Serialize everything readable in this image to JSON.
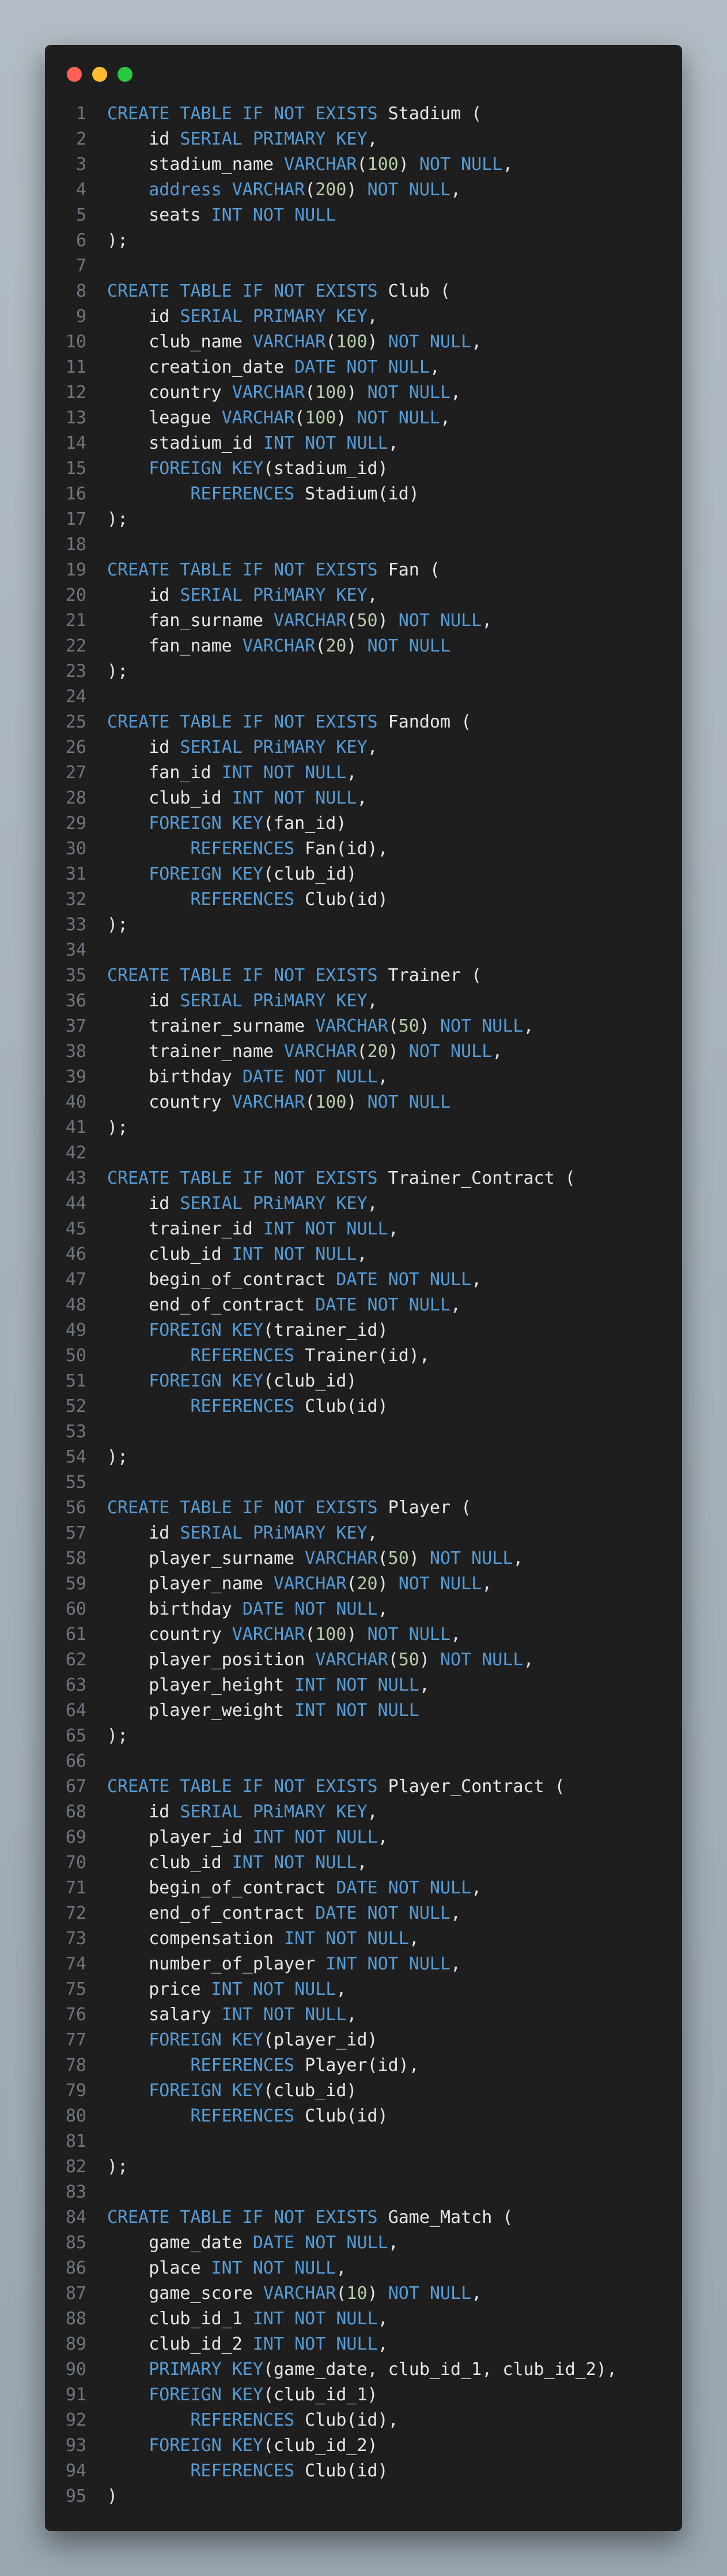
{
  "window": {
    "controls": [
      "close",
      "minimize",
      "maximize"
    ]
  },
  "colors": {
    "keyword": "#569cd6",
    "number": "#b5cea8",
    "text": "#e6e6e6",
    "line_number": "#6e7681",
    "background": "#1e1e1e"
  },
  "code": {
    "lines": [
      [
        [
          "k",
          "CREATE TABLE IF NOT EXISTS"
        ],
        [
          "p",
          " Stadium ("
        ]
      ],
      [
        [
          "p",
          "    id "
        ],
        [
          "k",
          "SERIAL PRIMARY KEY"
        ],
        [
          "p",
          ","
        ]
      ],
      [
        [
          "p",
          "    stadium_name "
        ],
        [
          "k",
          "VARCHAR"
        ],
        [
          "p",
          "("
        ],
        [
          "n",
          "100"
        ],
        [
          "p",
          ") "
        ],
        [
          "k",
          "NOT NULL"
        ],
        [
          "p",
          ","
        ]
      ],
      [
        [
          "p",
          "    "
        ],
        [
          "k",
          "address VARCHAR"
        ],
        [
          "p",
          "("
        ],
        [
          "n",
          "200"
        ],
        [
          "p",
          ") "
        ],
        [
          "k",
          "NOT NULL"
        ],
        [
          "p",
          ","
        ]
      ],
      [
        [
          "p",
          "    seats "
        ],
        [
          "k",
          "INT NOT NULL"
        ]
      ],
      [
        [
          "p",
          ");"
        ]
      ],
      [],
      [
        [
          "k",
          "CREATE TABLE IF NOT EXISTS"
        ],
        [
          "p",
          " Club ("
        ]
      ],
      [
        [
          "p",
          "    id "
        ],
        [
          "k",
          "SERIAL PRIMARY KEY"
        ],
        [
          "p",
          ","
        ]
      ],
      [
        [
          "p",
          "    club_name "
        ],
        [
          "k",
          "VARCHAR"
        ],
        [
          "p",
          "("
        ],
        [
          "n",
          "100"
        ],
        [
          "p",
          ") "
        ],
        [
          "k",
          "NOT NULL"
        ],
        [
          "p",
          ","
        ]
      ],
      [
        [
          "p",
          "    creation_date "
        ],
        [
          "k",
          "DATE NOT NULL"
        ],
        [
          "p",
          ","
        ]
      ],
      [
        [
          "p",
          "    country "
        ],
        [
          "k",
          "VARCHAR"
        ],
        [
          "p",
          "("
        ],
        [
          "n",
          "100"
        ],
        [
          "p",
          ") "
        ],
        [
          "k",
          "NOT NULL"
        ],
        [
          "p",
          ","
        ]
      ],
      [
        [
          "p",
          "    league "
        ],
        [
          "k",
          "VARCHAR"
        ],
        [
          "p",
          "("
        ],
        [
          "n",
          "100"
        ],
        [
          "p",
          ") "
        ],
        [
          "k",
          "NOT NULL"
        ],
        [
          "p",
          ","
        ]
      ],
      [
        [
          "p",
          "    stadium_id "
        ],
        [
          "k",
          "INT NOT NULL"
        ],
        [
          "p",
          ","
        ]
      ],
      [
        [
          "p",
          "    "
        ],
        [
          "k",
          "FOREIGN KEY"
        ],
        [
          "p",
          "(stadium_id)"
        ]
      ],
      [
        [
          "p",
          "        "
        ],
        [
          "k",
          "REFERENCES"
        ],
        [
          "p",
          " Stadium(id)"
        ]
      ],
      [
        [
          "p",
          ");"
        ]
      ],
      [],
      [
        [
          "k",
          "CREATE TABLE IF NOT EXISTS"
        ],
        [
          "p",
          " Fan ("
        ]
      ],
      [
        [
          "p",
          "    id "
        ],
        [
          "k",
          "SERIAL PRiMARY KEY"
        ],
        [
          "p",
          ","
        ]
      ],
      [
        [
          "p",
          "    fan_surname "
        ],
        [
          "k",
          "VARCHAR"
        ],
        [
          "p",
          "("
        ],
        [
          "n",
          "50"
        ],
        [
          "p",
          ") "
        ],
        [
          "k",
          "NOT NULL"
        ],
        [
          "p",
          ","
        ]
      ],
      [
        [
          "p",
          "    fan_name "
        ],
        [
          "k",
          "VARCHAR"
        ],
        [
          "p",
          "("
        ],
        [
          "n",
          "20"
        ],
        [
          "p",
          ") "
        ],
        [
          "k",
          "NOT NULL"
        ]
      ],
      [
        [
          "p",
          ");"
        ]
      ],
      [],
      [
        [
          "k",
          "CREATE TABLE IF NOT EXISTS"
        ],
        [
          "p",
          " Fandom ("
        ]
      ],
      [
        [
          "p",
          "    id "
        ],
        [
          "k",
          "SERIAL PRiMARY KEY"
        ],
        [
          "p",
          ","
        ]
      ],
      [
        [
          "p",
          "    fan_id "
        ],
        [
          "k",
          "INT NOT NULL"
        ],
        [
          "p",
          ","
        ]
      ],
      [
        [
          "p",
          "    club_id "
        ],
        [
          "k",
          "INT NOT NULL"
        ],
        [
          "p",
          ","
        ]
      ],
      [
        [
          "p",
          "    "
        ],
        [
          "k",
          "FOREIGN KEY"
        ],
        [
          "p",
          "(fan_id)"
        ]
      ],
      [
        [
          "p",
          "        "
        ],
        [
          "k",
          "REFERENCES"
        ],
        [
          "p",
          " Fan(id),"
        ]
      ],
      [
        [
          "p",
          "    "
        ],
        [
          "k",
          "FOREIGN KEY"
        ],
        [
          "p",
          "(club_id)"
        ]
      ],
      [
        [
          "p",
          "        "
        ],
        [
          "k",
          "REFERENCES"
        ],
        [
          "p",
          " Club(id)"
        ]
      ],
      [
        [
          "p",
          ");"
        ]
      ],
      [],
      [
        [
          "k",
          "CREATE TABLE IF NOT EXISTS"
        ],
        [
          "p",
          " Trainer ("
        ]
      ],
      [
        [
          "p",
          "    id "
        ],
        [
          "k",
          "SERIAL PRiMARY KEY"
        ],
        [
          "p",
          ","
        ]
      ],
      [
        [
          "p",
          "    trainer_surname "
        ],
        [
          "k",
          "VARCHAR"
        ],
        [
          "p",
          "("
        ],
        [
          "n",
          "50"
        ],
        [
          "p",
          ") "
        ],
        [
          "k",
          "NOT NULL"
        ],
        [
          "p",
          ","
        ]
      ],
      [
        [
          "p",
          "    trainer_name "
        ],
        [
          "k",
          "VARCHAR"
        ],
        [
          "p",
          "("
        ],
        [
          "n",
          "20"
        ],
        [
          "p",
          ") "
        ],
        [
          "k",
          "NOT NULL"
        ],
        [
          "p",
          ","
        ]
      ],
      [
        [
          "p",
          "    birthday "
        ],
        [
          "k",
          "DATE NOT NULL"
        ],
        [
          "p",
          ","
        ]
      ],
      [
        [
          "p",
          "    country "
        ],
        [
          "k",
          "VARCHAR"
        ],
        [
          "p",
          "("
        ],
        [
          "n",
          "100"
        ],
        [
          "p",
          ") "
        ],
        [
          "k",
          "NOT NULL"
        ]
      ],
      [
        [
          "p",
          ");"
        ]
      ],
      [],
      [
        [
          "k",
          "CREATE TABLE IF NOT EXISTS"
        ],
        [
          "p",
          " Trainer_Contract ("
        ]
      ],
      [
        [
          "p",
          "    id "
        ],
        [
          "k",
          "SERIAL PRiMARY KEY"
        ],
        [
          "p",
          ","
        ]
      ],
      [
        [
          "p",
          "    trainer_id "
        ],
        [
          "k",
          "INT NOT NULL"
        ],
        [
          "p",
          ","
        ]
      ],
      [
        [
          "p",
          "    club_id "
        ],
        [
          "k",
          "INT NOT NULL"
        ],
        [
          "p",
          ","
        ]
      ],
      [
        [
          "p",
          "    begin_of_contract "
        ],
        [
          "k",
          "DATE NOT NULL"
        ],
        [
          "p",
          ","
        ]
      ],
      [
        [
          "p",
          "    end_of_contract "
        ],
        [
          "k",
          "DATE NOT NULL"
        ],
        [
          "p",
          ","
        ]
      ],
      [
        [
          "p",
          "    "
        ],
        [
          "k",
          "FOREIGN KEY"
        ],
        [
          "p",
          "(trainer_id)"
        ]
      ],
      [
        [
          "p",
          "        "
        ],
        [
          "k",
          "REFERENCES"
        ],
        [
          "p",
          " Trainer(id),"
        ]
      ],
      [
        [
          "p",
          "    "
        ],
        [
          "k",
          "FOREIGN KEY"
        ],
        [
          "p",
          "(club_id)"
        ]
      ],
      [
        [
          "p",
          "        "
        ],
        [
          "k",
          "REFERENCES"
        ],
        [
          "p",
          " Club(id)"
        ]
      ],
      [],
      [
        [
          "p",
          ");"
        ]
      ],
      [],
      [
        [
          "k",
          "CREATE TABLE IF NOT EXISTS"
        ],
        [
          "p",
          " Player ("
        ]
      ],
      [
        [
          "p",
          "    id "
        ],
        [
          "k",
          "SERIAL PRiMARY KEY"
        ],
        [
          "p",
          ","
        ]
      ],
      [
        [
          "p",
          "    player_surname "
        ],
        [
          "k",
          "VARCHAR"
        ],
        [
          "p",
          "("
        ],
        [
          "n",
          "50"
        ],
        [
          "p",
          ") "
        ],
        [
          "k",
          "NOT NULL"
        ],
        [
          "p",
          ","
        ]
      ],
      [
        [
          "p",
          "    player_name "
        ],
        [
          "k",
          "VARCHAR"
        ],
        [
          "p",
          "("
        ],
        [
          "n",
          "20"
        ],
        [
          "p",
          ") "
        ],
        [
          "k",
          "NOT NULL"
        ],
        [
          "p",
          ","
        ]
      ],
      [
        [
          "p",
          "    birthday "
        ],
        [
          "k",
          "DATE NOT NULL"
        ],
        [
          "p",
          ","
        ]
      ],
      [
        [
          "p",
          "    country "
        ],
        [
          "k",
          "VARCHAR"
        ],
        [
          "p",
          "("
        ],
        [
          "n",
          "100"
        ],
        [
          "p",
          ") "
        ],
        [
          "k",
          "NOT NULL"
        ],
        [
          "p",
          ","
        ]
      ],
      [
        [
          "p",
          "    player_position "
        ],
        [
          "k",
          "VARCHAR"
        ],
        [
          "p",
          "("
        ],
        [
          "n",
          "50"
        ],
        [
          "p",
          ") "
        ],
        [
          "k",
          "NOT NULL"
        ],
        [
          "p",
          ","
        ]
      ],
      [
        [
          "p",
          "    player_height "
        ],
        [
          "k",
          "INT NOT NULL"
        ],
        [
          "p",
          ","
        ]
      ],
      [
        [
          "p",
          "    player_weight "
        ],
        [
          "k",
          "INT NOT NULL"
        ]
      ],
      [
        [
          "p",
          ");"
        ]
      ],
      [],
      [
        [
          "k",
          "CREATE TABLE IF NOT EXISTS"
        ],
        [
          "p",
          " Player_Contract ("
        ]
      ],
      [
        [
          "p",
          "    id "
        ],
        [
          "k",
          "SERIAL PRiMARY KEY"
        ],
        [
          "p",
          ","
        ]
      ],
      [
        [
          "p",
          "    player_id "
        ],
        [
          "k",
          "INT NOT NULL"
        ],
        [
          "p",
          ","
        ]
      ],
      [
        [
          "p",
          "    club_id "
        ],
        [
          "k",
          "INT NOT NULL"
        ],
        [
          "p",
          ","
        ]
      ],
      [
        [
          "p",
          "    begin_of_contract "
        ],
        [
          "k",
          "DATE NOT NULL"
        ],
        [
          "p",
          ","
        ]
      ],
      [
        [
          "p",
          "    end_of_contract "
        ],
        [
          "k",
          "DATE NOT NULL"
        ],
        [
          "p",
          ","
        ]
      ],
      [
        [
          "p",
          "    compensation "
        ],
        [
          "k",
          "INT NOT NULL"
        ],
        [
          "p",
          ","
        ]
      ],
      [
        [
          "p",
          "    number_of_player "
        ],
        [
          "k",
          "INT NOT NULL"
        ],
        [
          "p",
          ","
        ]
      ],
      [
        [
          "p",
          "    price "
        ],
        [
          "k",
          "INT NOT NULL"
        ],
        [
          "p",
          ","
        ]
      ],
      [
        [
          "p",
          "    salary "
        ],
        [
          "k",
          "INT NOT NULL"
        ],
        [
          "p",
          ","
        ]
      ],
      [
        [
          "p",
          "    "
        ],
        [
          "k",
          "FOREIGN KEY"
        ],
        [
          "p",
          "(player_id)"
        ]
      ],
      [
        [
          "p",
          "        "
        ],
        [
          "k",
          "REFERENCES"
        ],
        [
          "p",
          " Player(id),"
        ]
      ],
      [
        [
          "p",
          "    "
        ],
        [
          "k",
          "FOREIGN KEY"
        ],
        [
          "p",
          "(club_id)"
        ]
      ],
      [
        [
          "p",
          "        "
        ],
        [
          "k",
          "REFERENCES"
        ],
        [
          "p",
          " Club(id)"
        ]
      ],
      [],
      [
        [
          "p",
          ");"
        ]
      ],
      [],
      [
        [
          "k",
          "CREATE TABLE IF NOT EXISTS"
        ],
        [
          "p",
          " Game_Match ("
        ]
      ],
      [
        [
          "p",
          "    game_date "
        ],
        [
          "k",
          "DATE NOT NULL"
        ],
        [
          "p",
          ","
        ]
      ],
      [
        [
          "p",
          "    place "
        ],
        [
          "k",
          "INT NOT NULL"
        ],
        [
          "p",
          ","
        ]
      ],
      [
        [
          "p",
          "    game_score "
        ],
        [
          "k",
          "VARCHAR"
        ],
        [
          "p",
          "("
        ],
        [
          "n",
          "10"
        ],
        [
          "p",
          ") "
        ],
        [
          "k",
          "NOT NULL"
        ],
        [
          "p",
          ","
        ]
      ],
      [
        [
          "p",
          "    club_id_1 "
        ],
        [
          "k",
          "INT NOT NULL"
        ],
        [
          "p",
          ","
        ]
      ],
      [
        [
          "p",
          "    club_id_2 "
        ],
        [
          "k",
          "INT NOT NULL"
        ],
        [
          "p",
          ","
        ]
      ],
      [
        [
          "p",
          "    "
        ],
        [
          "k",
          "PRIMARY KEY"
        ],
        [
          "p",
          "(game_date, club_id_1, club_id_2),"
        ]
      ],
      [
        [
          "p",
          "    "
        ],
        [
          "k",
          "FOREIGN KEY"
        ],
        [
          "p",
          "(club_id_1)"
        ]
      ],
      [
        [
          "p",
          "        "
        ],
        [
          "k",
          "REFERENCES"
        ],
        [
          "p",
          " Club(id),"
        ]
      ],
      [
        [
          "p",
          "    "
        ],
        [
          "k",
          "FOREIGN KEY"
        ],
        [
          "p",
          "(club_id_2)"
        ]
      ],
      [
        [
          "p",
          "        "
        ],
        [
          "k",
          "REFERENCES"
        ],
        [
          "p",
          " Club(id)"
        ]
      ],
      [
        [
          "p",
          ")"
        ]
      ]
    ]
  }
}
